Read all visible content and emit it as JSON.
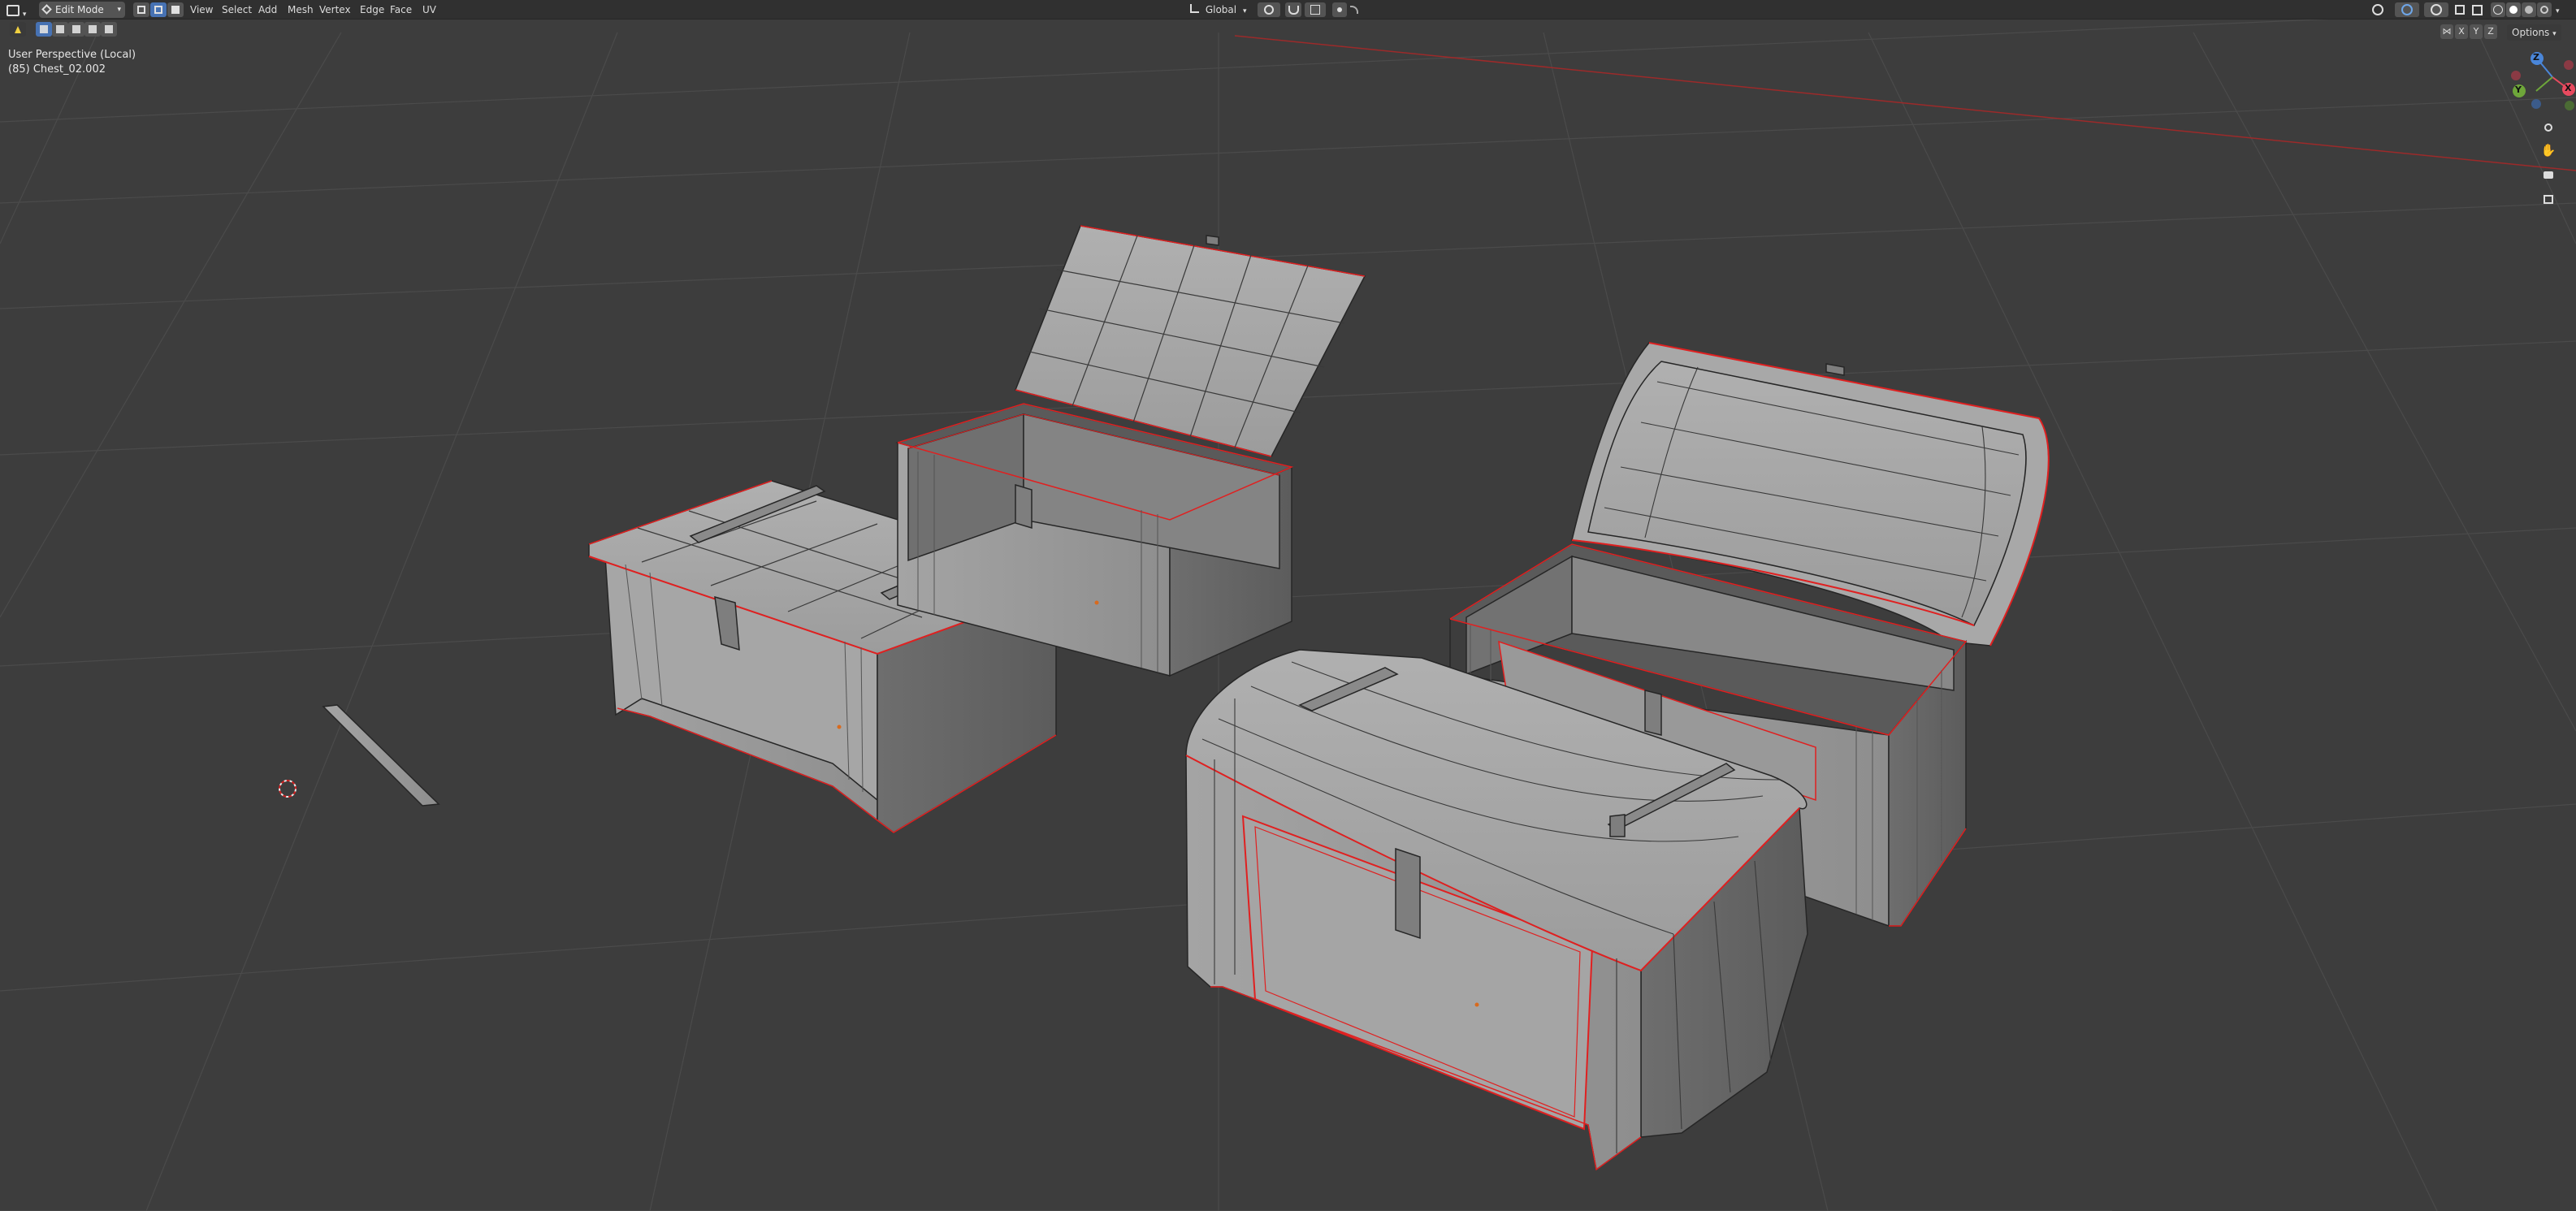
{
  "header": {
    "editor_type_icon": "3d-viewport-icon",
    "mode_label": "Edit Mode",
    "menus": [
      "View",
      "Select",
      "Add",
      "Mesh",
      "Vertex",
      "Edge",
      "Face",
      "UV"
    ],
    "transform_orientation": "Global"
  },
  "viewport": {
    "view_label": "User Perspective (Local)",
    "object_label": "(85) Chest_02.002",
    "options_label": "Options",
    "axes": {
      "x": "X",
      "y": "Y",
      "z": "Z"
    },
    "colors": {
      "background": "#3d3d3d",
      "grid": "#4a4a4a",
      "x_axis": "#9c2a2a",
      "mesh_face": "#9a9a9a",
      "mesh_edge": "#2a2a2a",
      "seam": "#e02020",
      "gizmo_x": "#e84a5f",
      "gizmo_y": "#6ea63a",
      "gizmo_z": "#4a86d9"
    }
  },
  "nav_icons": [
    "zoom-icon",
    "pan-hand-icon",
    "camera-icon",
    "perspective-grid-icon"
  ]
}
